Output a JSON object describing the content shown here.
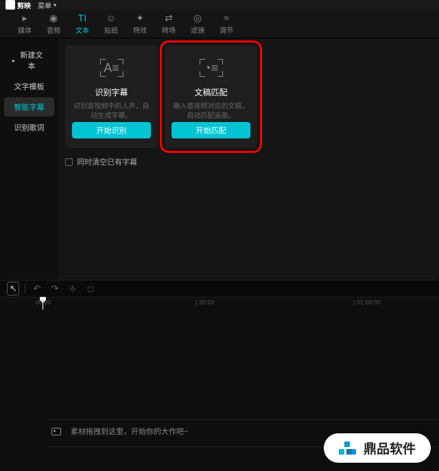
{
  "titlebar": {
    "app_name": "剪映",
    "menu_label": "菜单"
  },
  "tabs": [
    {
      "icon": "▸",
      "label": "媒体"
    },
    {
      "icon": "◉",
      "label": "音频"
    },
    {
      "icon": "TI",
      "label": "文本"
    },
    {
      "icon": "☺",
      "label": "贴纸"
    },
    {
      "icon": "✦",
      "label": "特效"
    },
    {
      "icon": "⇄",
      "label": "转场"
    },
    {
      "icon": "◎",
      "label": "滤镜"
    },
    {
      "icon": "≈",
      "label": "调节"
    }
  ],
  "sidebar": {
    "items": [
      {
        "label": "新建文本",
        "has_caret": true
      },
      {
        "label": "文字模板"
      },
      {
        "label": "智能字幕",
        "active": true
      },
      {
        "label": "识别歌词"
      }
    ]
  },
  "cards": [
    {
      "glyph": "A≡",
      "title": "识别字幕",
      "desc": "识别音视频中的人声，自动生成字幕。",
      "button": "开始识别"
    },
    {
      "glyph": "◔≡",
      "title": "文稿匹配",
      "desc": "输入音视频对应的文稿，自动匹配画面。",
      "button": "开始匹配"
    }
  ],
  "checkbox": {
    "label": "同时清空已有字幕"
  },
  "ruler": {
    "m1": "00:00",
    "m2": "| 30:00",
    "m3": "| 01:00:00"
  },
  "timeline": {
    "hint": "素材拖拽到这里，开始你的大作吧~"
  },
  "watermark": {
    "text": "鼎品软件"
  }
}
